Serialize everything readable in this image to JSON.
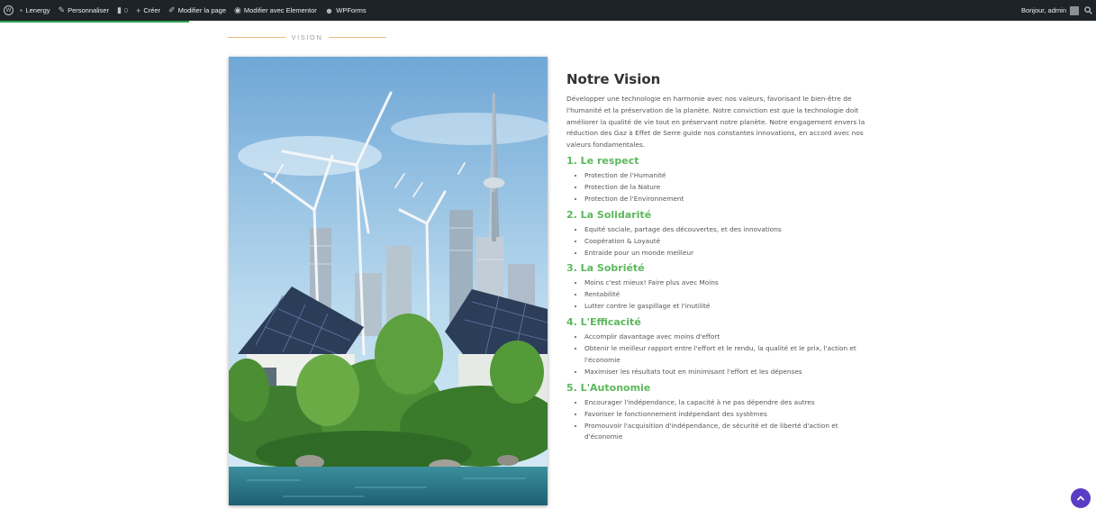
{
  "adminbar": {
    "site_name": "Lenergy",
    "customize": "Personnaliser",
    "comments_count": "0",
    "new": "Créer",
    "edit_page": "Modifier la page",
    "elementor": "Modifier avec Elementor",
    "wpforms": "WPForms",
    "greeting": "Bonjour, admin"
  },
  "vision": {
    "section_label": "VISION",
    "title": "Notre Vision",
    "intro": "Développer une technologie en harmonie avec nos valeurs, favorisant le bien-être de l'humanité et la préservation de la planète. Notre conviction est que la technologie doit améliorer la qualité de vie tout en préservant notre planète. Notre engagement envers la réduction des Gaz à Effet de Serre guide nos constantes innovations, en accord avec nos valeurs fondamentales.",
    "sections": [
      {
        "heading": "1. Le respect",
        "items": [
          "Protection de l'Humanité",
          "Protection de la Nature",
          "Protection de l'Environnement"
        ]
      },
      {
        "heading": "2. La Solidarité",
        "items": [
          "Equité sociale, partage des découvertes, et des innovations",
          "Coopération & Loyauté",
          "Entraide pour un monde meilleur"
        ]
      },
      {
        "heading": "3. La Sobriété",
        "items": [
          "Moins c'est mieux! Faire plus avec Moins",
          "Rentabilité",
          "Lutter contre le gaspillage et l'inutilité"
        ]
      },
      {
        "heading": "4. L'Efficacité",
        "items": [
          "Accomplir davantage avec moins d'effort",
          "Obtenir le meilleur rapport entre l'effort et le rendu, la qualité et le prix, l'action et l'économie",
          "Maximiser les résultats tout en minimisant l'effort et les dépenses"
        ]
      },
      {
        "heading": "5. L'Autonomie",
        "items": [
          "Encourager l'indépendance, la capacité à ne pas dépendre des autres",
          "Favoriser le fonctionnement indépendant des systèmes",
          "Promouvoir l'acquisition d'indépendance, de sécurité et de liberté d'action et d'économie"
        ]
      }
    ]
  },
  "colors": {
    "adminbar_bg": "#1d2327",
    "heading_green": "#5cb85c",
    "accent_orange": "#f1b97a",
    "scroll_button": "#5b3cc4"
  },
  "icons": [
    "wordpress-icon",
    "dashboard-icon",
    "brush-icon",
    "comment-icon",
    "plus-icon",
    "pencil-icon",
    "elementor-icon",
    "wpforms-icon",
    "search-icon",
    "chevron-up-icon"
  ]
}
